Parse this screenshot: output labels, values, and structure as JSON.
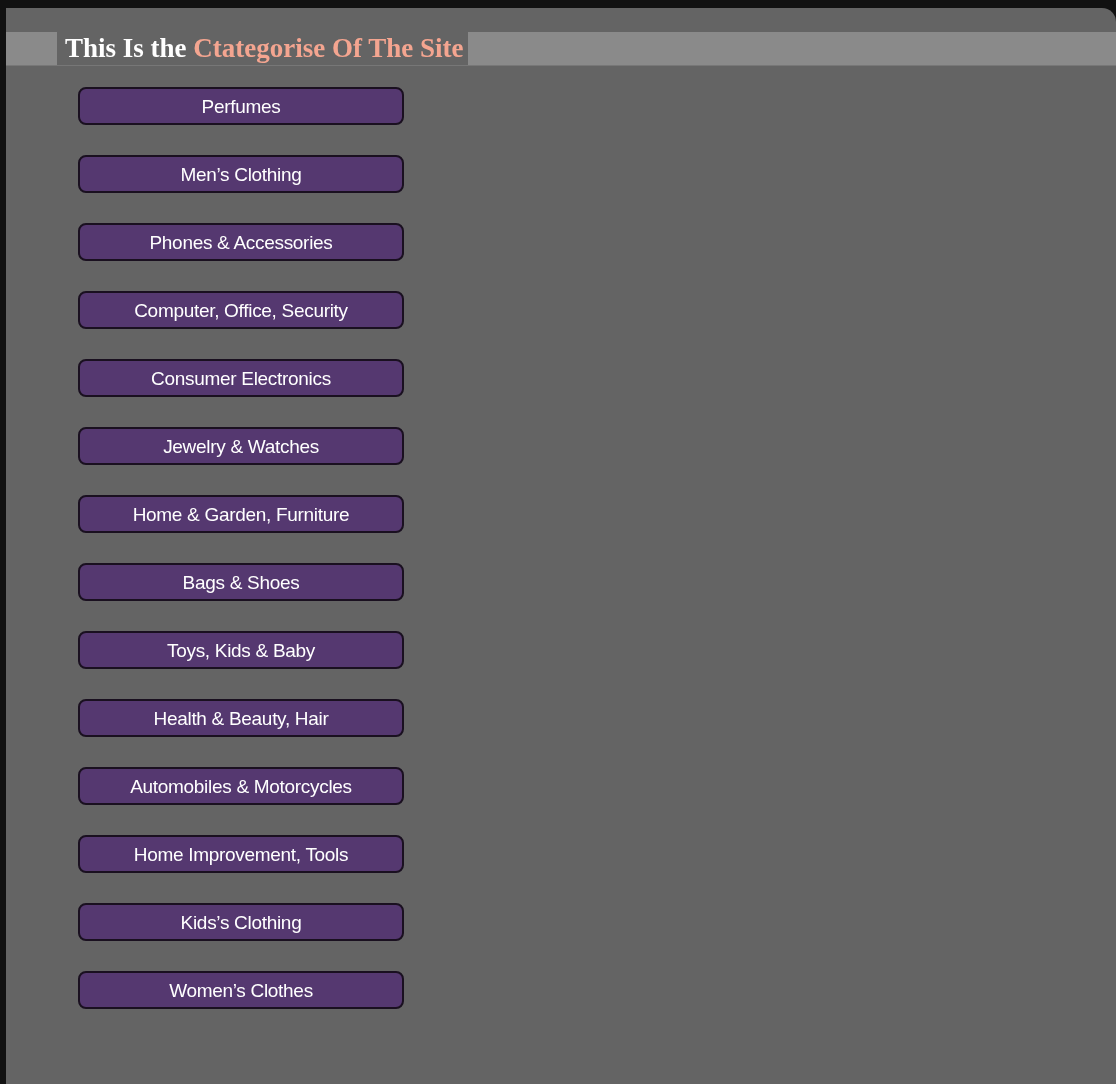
{
  "heading": {
    "lead": "This Is the",
    "highlight": "Ctategorise Of The Site"
  },
  "categories": [
    {
      "label": "Perfumes"
    },
    {
      "label": "Men’s Clothing"
    },
    {
      "label": "Phones & Accessories"
    },
    {
      "label": "Computer, Office, Security"
    },
    {
      "label": "Consumer Electronics"
    },
    {
      "label": "Jewelry & Watches"
    },
    {
      "label": "Home & Garden, Furniture"
    },
    {
      "label": "Bags & Shoes"
    },
    {
      "label": "Toys, Kids & Baby"
    },
    {
      "label": "Health & Beauty, Hair"
    },
    {
      "label": "Automobiles & Motorcycles"
    },
    {
      "label": "Home Improvement, Tools"
    },
    {
      "label": "Kids’s Clothing"
    },
    {
      "label": "Women’s Clothes"
    }
  ]
}
